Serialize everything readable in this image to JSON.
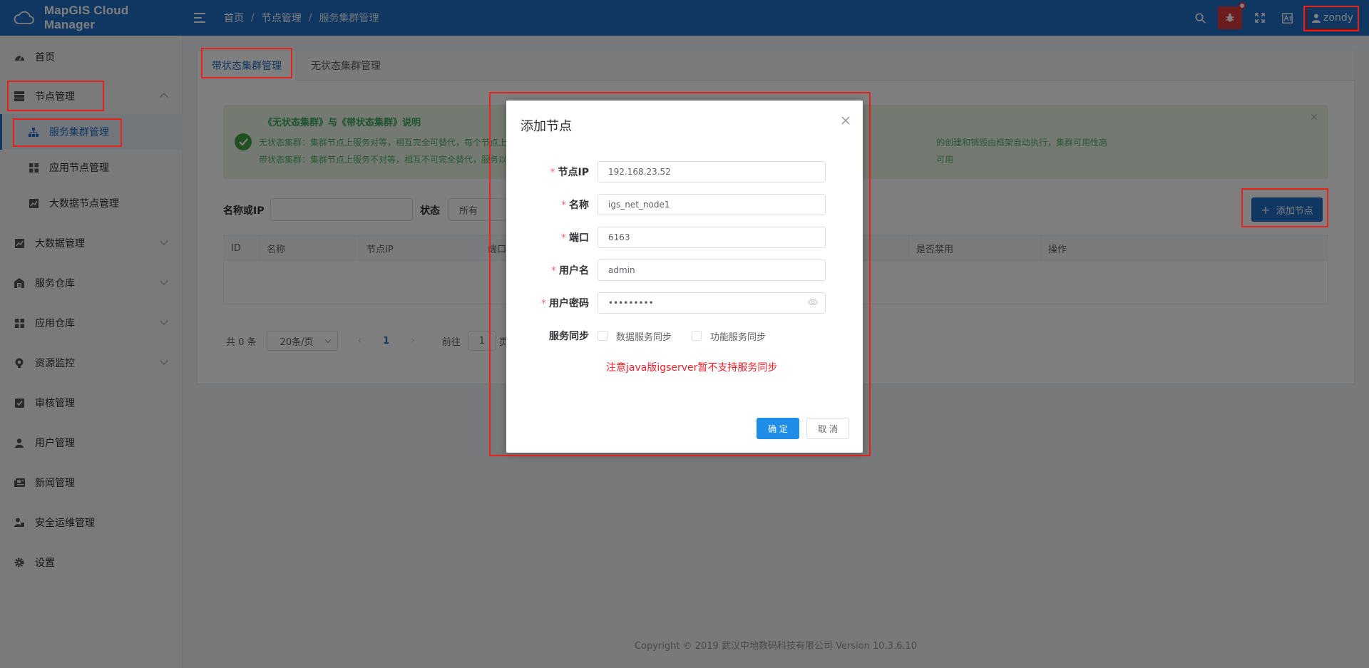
{
  "header": {
    "app_title": "MapGIS Cloud Manager",
    "breadcrumb": [
      "首页",
      "节点管理",
      "服务集群管理"
    ],
    "user_name": "zondy",
    "bug_label": "bug"
  },
  "sidebar": {
    "items": [
      {
        "label": "首页",
        "icon": "dashboard-icon"
      },
      {
        "label": "节点管理",
        "icon": "server-icon",
        "expanded": true
      },
      {
        "label": "服务集群管理",
        "icon": "sitemap-icon",
        "active": true,
        "sub": true
      },
      {
        "label": "应用节点管理",
        "icon": "grid-icon",
        "sub": true
      },
      {
        "label": "大数据节点管理",
        "icon": "chart-icon",
        "sub": true
      },
      {
        "label": "大数据管理",
        "icon": "chart-icon"
      },
      {
        "label": "服务仓库",
        "icon": "warehouse-icon"
      },
      {
        "label": "应用仓库",
        "icon": "grid-icon"
      },
      {
        "label": "资源监控",
        "icon": "monitor-icon"
      },
      {
        "label": "审核管理",
        "icon": "audit-icon"
      },
      {
        "label": "用户管理",
        "icon": "user-icon"
      },
      {
        "label": "新闻管理",
        "icon": "news-icon"
      },
      {
        "label": "安全运维管理",
        "icon": "security-icon"
      },
      {
        "label": "设置",
        "icon": "gear-icon"
      }
    ]
  },
  "main": {
    "tabs": [
      "带状态集群管理",
      "无状态集群管理"
    ],
    "alert": {
      "title": "《无状态集群》与《带状态集群》说明",
      "line1": "无状态集群：集群节点上服务对等，相互完全可替代，每个节点上",
      "line1_tail": "的创建和销毁由框架自动执行，集群可用性高",
      "line2": "带状态集群：集群节点上服务不对等，相互不可完全替代，服务以",
      "line2_tail": "可用"
    },
    "filter": {
      "name_label": "名称或IP",
      "name_value": "",
      "status_label": "状态",
      "status_value": "所有"
    },
    "add_button": "添加节点",
    "table_headers": [
      "ID",
      "名称",
      "节点IP",
      "端口",
      "是否禁用",
      "操作"
    ],
    "pager": {
      "total": "共 0 条",
      "page_size": "20条/页",
      "current": "1",
      "goto_label": "前往",
      "goto_value": "1",
      "page_suffix": "页"
    }
  },
  "dialog": {
    "title": "添加节点",
    "fields": [
      {
        "label": "节点IP",
        "value": "192.168.23.52",
        "required": true
      },
      {
        "label": "名称",
        "value": "igs_net_node1",
        "required": true
      },
      {
        "label": "端口",
        "value": "6163",
        "required": true
      },
      {
        "label": "用户名",
        "value": "admin",
        "required": true
      },
      {
        "label": "用户密码",
        "value": "•••••••••",
        "required": true
      }
    ],
    "sync_label": "服务同步",
    "sync_options": [
      "数据服务同步",
      "功能服务同步"
    ],
    "note": "注意java版igserver暂不支持服务同步",
    "ok": "确 定",
    "cancel": "取 消"
  },
  "footer": "Copyright © 2019 武汉中地数码科技有限公司 Version 10.3.6.10",
  "colors": {
    "header_bg": "#1f6fc5",
    "accent": "#1f6fc5",
    "highlight": "#e5231b",
    "note": "#f5222d"
  }
}
